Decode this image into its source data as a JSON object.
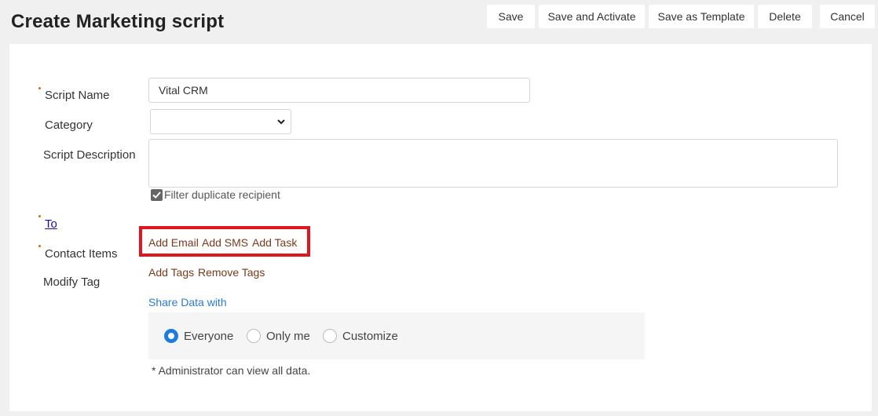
{
  "page": {
    "title": "Create Marketing script"
  },
  "toolbar": {
    "save": "Save",
    "save_activate": "Save and Activate",
    "save_template": "Save as Template",
    "delete": "Delete",
    "cancel": "Cancel"
  },
  "form": {
    "script_name_label": "Script Name",
    "script_name_value": "Vital CRM",
    "category_label": "Category",
    "category_value": "",
    "description_label": "Script Description",
    "description_value": "",
    "filter_duplicate_label": "Filter duplicate recipient",
    "filter_duplicate_checked": true,
    "to_label": "To",
    "contact_items_label": "Contact Items",
    "add_email": "Add Email",
    "add_sms": "Add SMS",
    "add_task": "Add Task",
    "modify_tag_label": "Modify Tag",
    "add_tags": "Add Tags",
    "remove_tags": "Remove Tags",
    "share_data_label": "Share Data with",
    "share_options": [
      "Everyone",
      "Only me",
      "Customize"
    ],
    "share_selected": "Everyone",
    "note": "*  Administrator can view all data."
  },
  "colors": {
    "required_marker": "#d4691e",
    "action_link": "#7a3a1a",
    "share_link": "#2a7bd6",
    "radio_selected": "#1e7be0",
    "highlight": "#e0161e"
  }
}
